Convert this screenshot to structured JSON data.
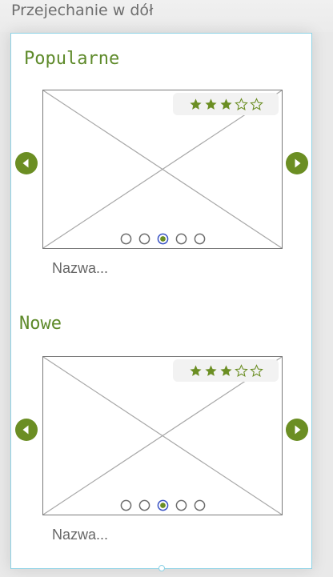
{
  "page": {
    "title": "Przejechanie w dół"
  },
  "colors": {
    "accent": "#6b8e23",
    "panel_border": "#8fd3e6",
    "active_dot_ring": "#3a53c4"
  },
  "sections": [
    {
      "heading": "Popularne",
      "item_name": "Nazwa...",
      "rating": {
        "value": 3,
        "max": 5
      },
      "pager": {
        "total": 5,
        "active": 3
      },
      "prev_icon": "arrow-left-circle-icon",
      "next_icon": "arrow-right-circle-icon"
    },
    {
      "heading": "Nowe",
      "item_name": "Nazwa...",
      "rating": {
        "value": 3,
        "max": 5
      },
      "pager": {
        "total": 5,
        "active": 3
      },
      "prev_icon": "arrow-left-circle-icon",
      "next_icon": "arrow-right-circle-icon"
    }
  ]
}
